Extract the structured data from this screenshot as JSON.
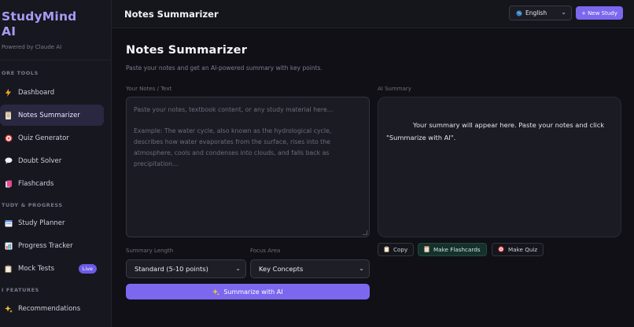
{
  "sidebar": {
    "brand_title": "StudyMind AI",
    "brand_line1": "StudyMind",
    "brand_line2": "AI",
    "brand_sub": "Powered by Claude AI",
    "sections": [
      {
        "label": "ORE TOOLS"
      },
      {
        "label": "TUDY & PROGRESS"
      },
      {
        "label": "I FEATURES"
      }
    ],
    "items": [
      {
        "label": "Dashboard",
        "icon": "lightning-icon"
      },
      {
        "label": "Notes Summarizer",
        "icon": "notepad-icon",
        "active": true
      },
      {
        "label": "Quiz Generator",
        "icon": "target-icon"
      },
      {
        "label": "Doubt Solver",
        "icon": "speech-bubble-icon"
      },
      {
        "label": "Flashcards",
        "icon": "cards-icon"
      },
      {
        "label": "Study Planner",
        "icon": "calendar-icon"
      },
      {
        "label": "Progress Tracker",
        "icon": "bar-chart-icon"
      },
      {
        "label": "Mock Tests",
        "icon": "clipboard-icon",
        "badge": "Live"
      },
      {
        "label": "Recommendations",
        "icon": "sparkles-icon"
      }
    ]
  },
  "topbar": {
    "title": "Notes Summarizer",
    "language": "English",
    "new_study": "+ New Study"
  },
  "page": {
    "title": "Notes Summarizer",
    "subtitle": "Paste your notes and get an AI-powered summary with key points."
  },
  "notes": {
    "label": "Your Notes / Text",
    "placeholder_line1": "Paste your notes, textbook content, or any study material here...",
    "placeholder_example": "Example: The water cycle, also known as the hydrological cycle, describes how water evaporates from the surface, rises into the atmosphere, cools and condenses into clouds, and falls back as precipitation..."
  },
  "summary": {
    "label": "AI Summary",
    "placeholder": "Your summary will appear here. Paste your notes and click \"Summarize with AI\"."
  },
  "actions": {
    "copy": "Copy",
    "flashcards": "Make Flashcards",
    "quiz": "Make Quiz"
  },
  "options": {
    "length_label": "Summary Length",
    "length_value": "Standard (5-10 points)",
    "focus_label": "Focus Area",
    "focus_value": "Key Concepts"
  },
  "summarize_button": "Summarize with AI",
  "colors": {
    "accent": "#7b68ee",
    "brand": "#a59cf5",
    "sidebar_bg": "#17171f",
    "main_bg": "#101016"
  }
}
